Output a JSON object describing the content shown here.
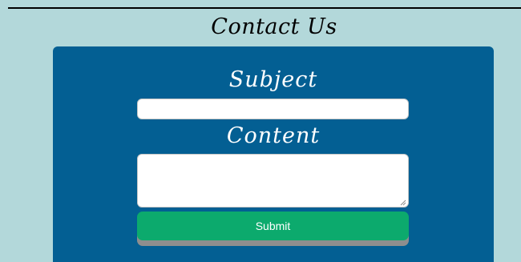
{
  "page": {
    "title": "Contact Us"
  },
  "form": {
    "subject_label": "Subject",
    "subject_value": "",
    "content_label": "Content",
    "content_value": "",
    "submit_label": "Submit"
  },
  "colors": {
    "background": "#b3d8da",
    "panel": "#035f93",
    "submit": "#0caa6d",
    "submit_shadow": "#8e8e8e"
  },
  "icons": {
    "textarea_resize": "resize-grip-icon"
  }
}
